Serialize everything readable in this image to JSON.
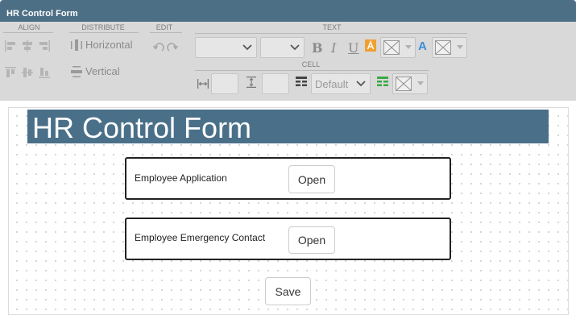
{
  "window": {
    "title": "HR Control Form"
  },
  "toolbar": {
    "groups": {
      "align": "ALIGN",
      "distribute": "DISTRIBUTE",
      "edit": "EDIT",
      "text": "TEXT",
      "cell": "CELL"
    },
    "distribute_horizontal": "Horizontal",
    "distribute_vertical": "Vertical",
    "text_format": {
      "bold": "B",
      "italic": "I",
      "underline": "U",
      "font_color": "A"
    },
    "cell_style_value": "Default",
    "colors": {
      "highlight": "#f0a030",
      "font_color": "#3a8ed8",
      "cell_green": "#3aa845"
    }
  },
  "form": {
    "header_title": "HR Control Form",
    "rows": [
      {
        "label": "Employee Application",
        "button": "Open"
      },
      {
        "label": "Employee Emergency Contact",
        "button": "Open"
      }
    ],
    "save_label": "Save"
  }
}
